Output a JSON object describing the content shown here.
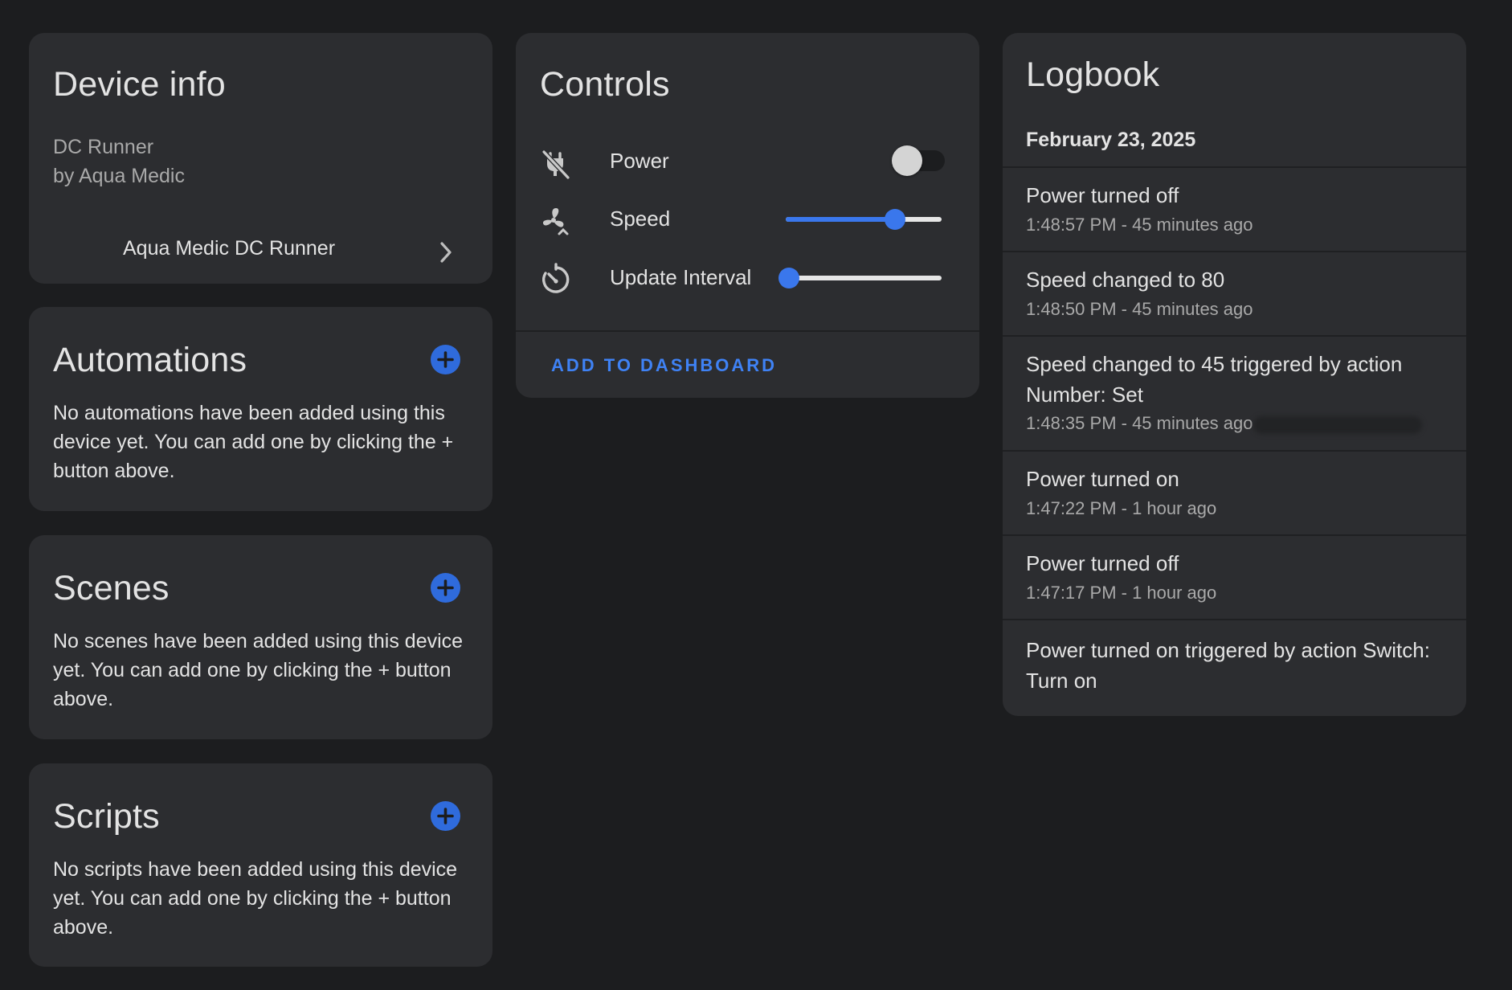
{
  "device_info": {
    "title": "Device info",
    "model": "DC Runner",
    "manufacturer": "by Aqua Medic",
    "link_label": "Aqua Medic DC Runner",
    "link_icon": "chevron-right-icon"
  },
  "automations": {
    "title": "Automations",
    "empty_text": "No automations have been added using this device yet. You can add one by clicking the + button above.",
    "add_icon": "plus-circle-icon"
  },
  "scenes": {
    "title": "Scenes",
    "empty_text": "No scenes have been added using this device yet. You can add one by clicking the + button above.",
    "add_icon": "plus-circle-icon"
  },
  "scripts": {
    "title": "Scripts",
    "empty_text": "No scripts have been added using this device yet. You can add one by clicking the + button above.",
    "add_icon": "plus-circle-icon"
  },
  "controls": {
    "title": "Controls",
    "items": [
      {
        "label": "Power",
        "icon": "power-plug-off-icon",
        "type": "switch",
        "state": "off"
      },
      {
        "label": "Speed",
        "icon": "fan-speed-icon",
        "type": "slider",
        "value_fraction": 0.7
      },
      {
        "label": "Update Interval",
        "icon": "timer-icon",
        "type": "slider",
        "value_fraction": 0.0
      }
    ],
    "action_label": "ADD TO DASHBOARD"
  },
  "logbook": {
    "title": "Logbook",
    "date": "February 23, 2025",
    "entries": [
      {
        "message": "Power turned off",
        "time": "1:48:57 PM - 45 minutes ago"
      },
      {
        "message": "Speed changed to 80",
        "time": "1:48:50 PM - 45 minutes ago"
      },
      {
        "message": "Speed changed to 45 triggered by action Number: Set",
        "time": "1:48:35 PM - 45 minutes ago"
      },
      {
        "message": "Power turned on",
        "time": "1:47:22 PM - 1 hour ago"
      },
      {
        "message": "Power turned off",
        "time": "1:47:17 PM - 1 hour ago"
      },
      {
        "message": "Power turned on triggered by action Switch: Turn on",
        "time": ""
      }
    ]
  },
  "colors": {
    "background": "#1c1d1f",
    "card": "#2c2d30",
    "accent": "#3a77ec",
    "text_primary": "#e3e3e3",
    "text_secondary": "#a9a9a9"
  }
}
